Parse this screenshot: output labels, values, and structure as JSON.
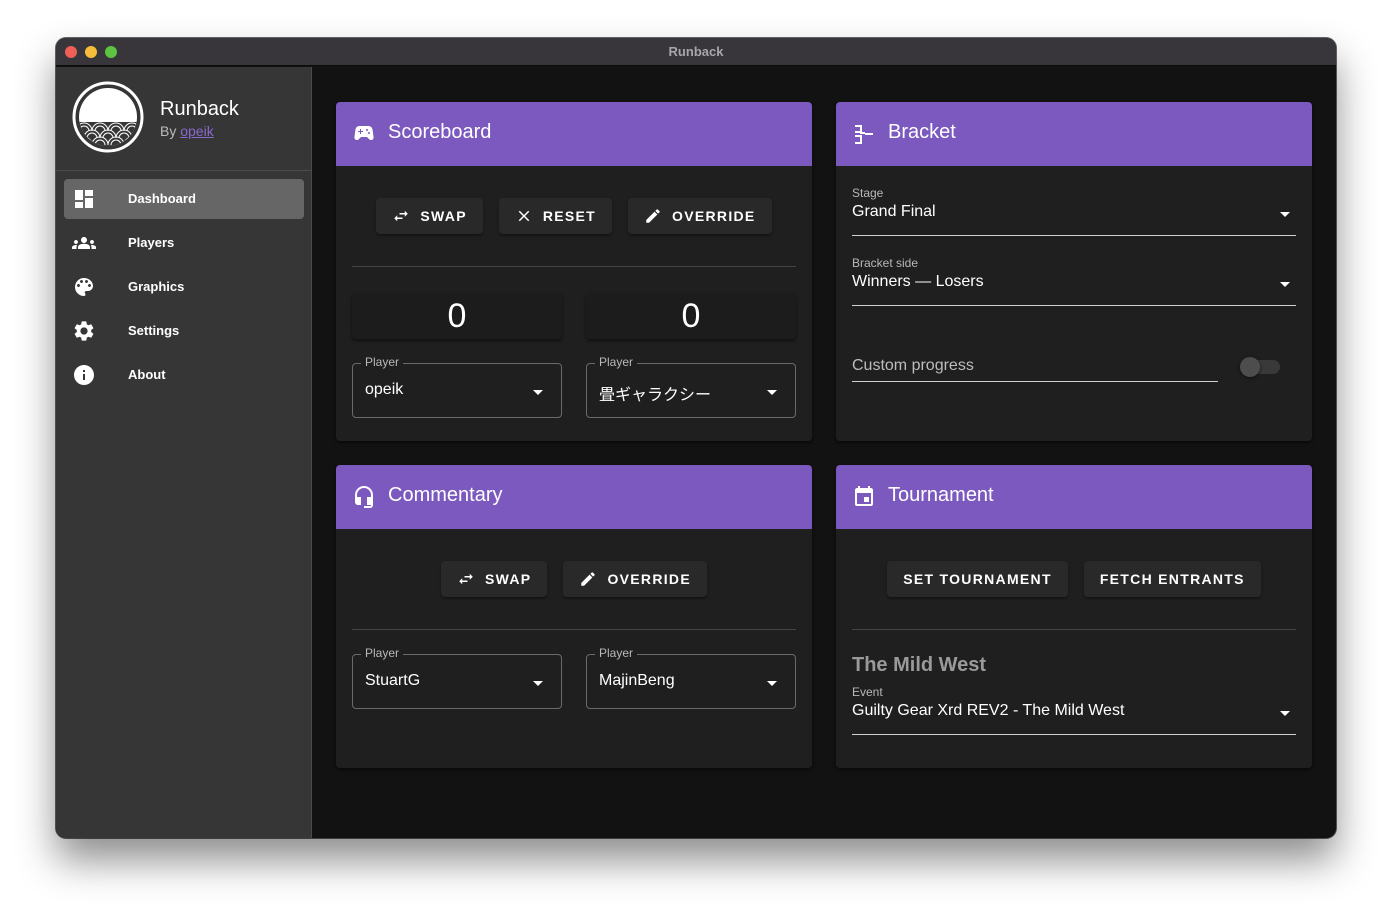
{
  "window": {
    "title": "Runback",
    "traffic_lights": [
      "close",
      "minimize",
      "maximize"
    ]
  },
  "sidebar": {
    "app_name": "Runback",
    "by_prefix": "By",
    "author": "opeik",
    "items": [
      {
        "label": "Dashboard",
        "icon": "dashboard-icon",
        "active": true
      },
      {
        "label": "Players",
        "icon": "people-icon",
        "active": false
      },
      {
        "label": "Graphics",
        "icon": "palette-icon",
        "active": false
      },
      {
        "label": "Settings",
        "icon": "gear-icon",
        "active": false
      },
      {
        "label": "About",
        "icon": "info-icon",
        "active": false
      }
    ]
  },
  "colors": {
    "accent": "#7b59be",
    "link": "#8a68cf",
    "sidebar_bg": "#363636",
    "main_bg": "#121212",
    "card_bg": "#1f1f1f"
  },
  "scoreboard": {
    "title": "Scoreboard",
    "icon": "gamepad-icon",
    "buttons": {
      "swap": "SWAP",
      "reset": "RESET",
      "override": "OVERRIDE"
    },
    "scores": [
      "0",
      "0"
    ],
    "players": [
      {
        "label": "Player",
        "value": "opeik"
      },
      {
        "label": "Player",
        "value": "畳ギャラクシー"
      }
    ]
  },
  "bracket": {
    "title": "Bracket",
    "icon": "bracket-icon",
    "stage": {
      "label": "Stage",
      "value": "Grand Final"
    },
    "side": {
      "label": "Bracket side",
      "value": "Winners — Losers"
    },
    "custom_progress": {
      "placeholder": "Custom progress",
      "enabled": false
    }
  },
  "commentary": {
    "title": "Commentary",
    "icon": "headset-icon",
    "buttons": {
      "swap": "SWAP",
      "override": "OVERRIDE"
    },
    "players": [
      {
        "label": "Player",
        "value": "StuartG"
      },
      {
        "label": "Player",
        "value": "MajinBeng"
      }
    ]
  },
  "tournament": {
    "title": "Tournament",
    "icon": "calendar-icon",
    "buttons": {
      "set": "SET TOURNAMENT",
      "fetch": "FETCH ENTRANTS"
    },
    "name": "The Mild West",
    "event": {
      "label": "Event",
      "value": "Guilty Gear Xrd REV2 - The Mild West"
    }
  }
}
